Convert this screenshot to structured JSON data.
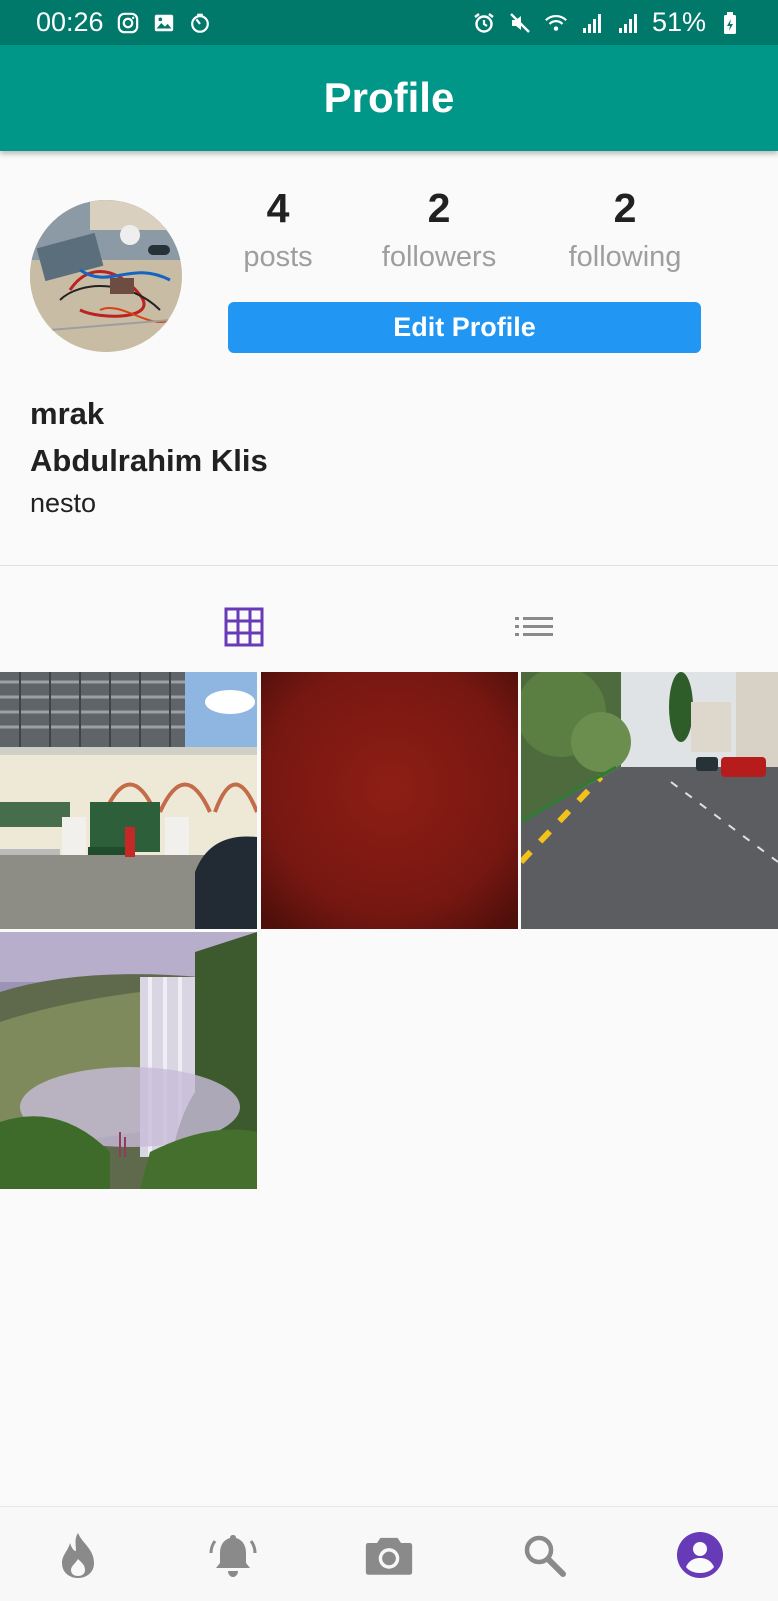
{
  "status_bar": {
    "time": "00:26",
    "battery": "51%",
    "left_icons": [
      "instagram-icon",
      "gallery-icon",
      "timer-icon"
    ],
    "right_icons": [
      "alarm-icon",
      "mute-icon",
      "wifi-icon",
      "signal-icon",
      "signal-icon",
      "battery-icon"
    ]
  },
  "app_bar": {
    "title": "Profile"
  },
  "profile": {
    "stats": [
      {
        "value": "4",
        "label": "posts"
      },
      {
        "value": "2",
        "label": "followers"
      },
      {
        "value": "2",
        "label": "following"
      }
    ],
    "edit_button": "Edit Profile",
    "username": "mrak",
    "full_name": "Abdulrahim Klis",
    "bio": "nesto"
  },
  "tabs": [
    {
      "icon": "grid-icon",
      "active": true
    },
    {
      "icon": "list-icon",
      "active": false
    }
  ],
  "posts": [
    {
      "icon": "photo-building"
    },
    {
      "icon": "photo-red"
    },
    {
      "icon": "photo-street"
    },
    {
      "icon": "photo-waterfall"
    }
  ],
  "bottom_nav": [
    {
      "icon": "fire-icon",
      "active": false
    },
    {
      "icon": "bell-icon",
      "active": false
    },
    {
      "icon": "camera-icon",
      "active": false
    },
    {
      "icon": "search-icon",
      "active": false
    },
    {
      "icon": "account-icon",
      "active": true
    }
  ],
  "colors": {
    "status_bar": "#00796b",
    "app_bar": "#009688",
    "button": "#2196f3",
    "active_icon": "#673ab7",
    "inactive_icon": "#8a8a8a"
  }
}
